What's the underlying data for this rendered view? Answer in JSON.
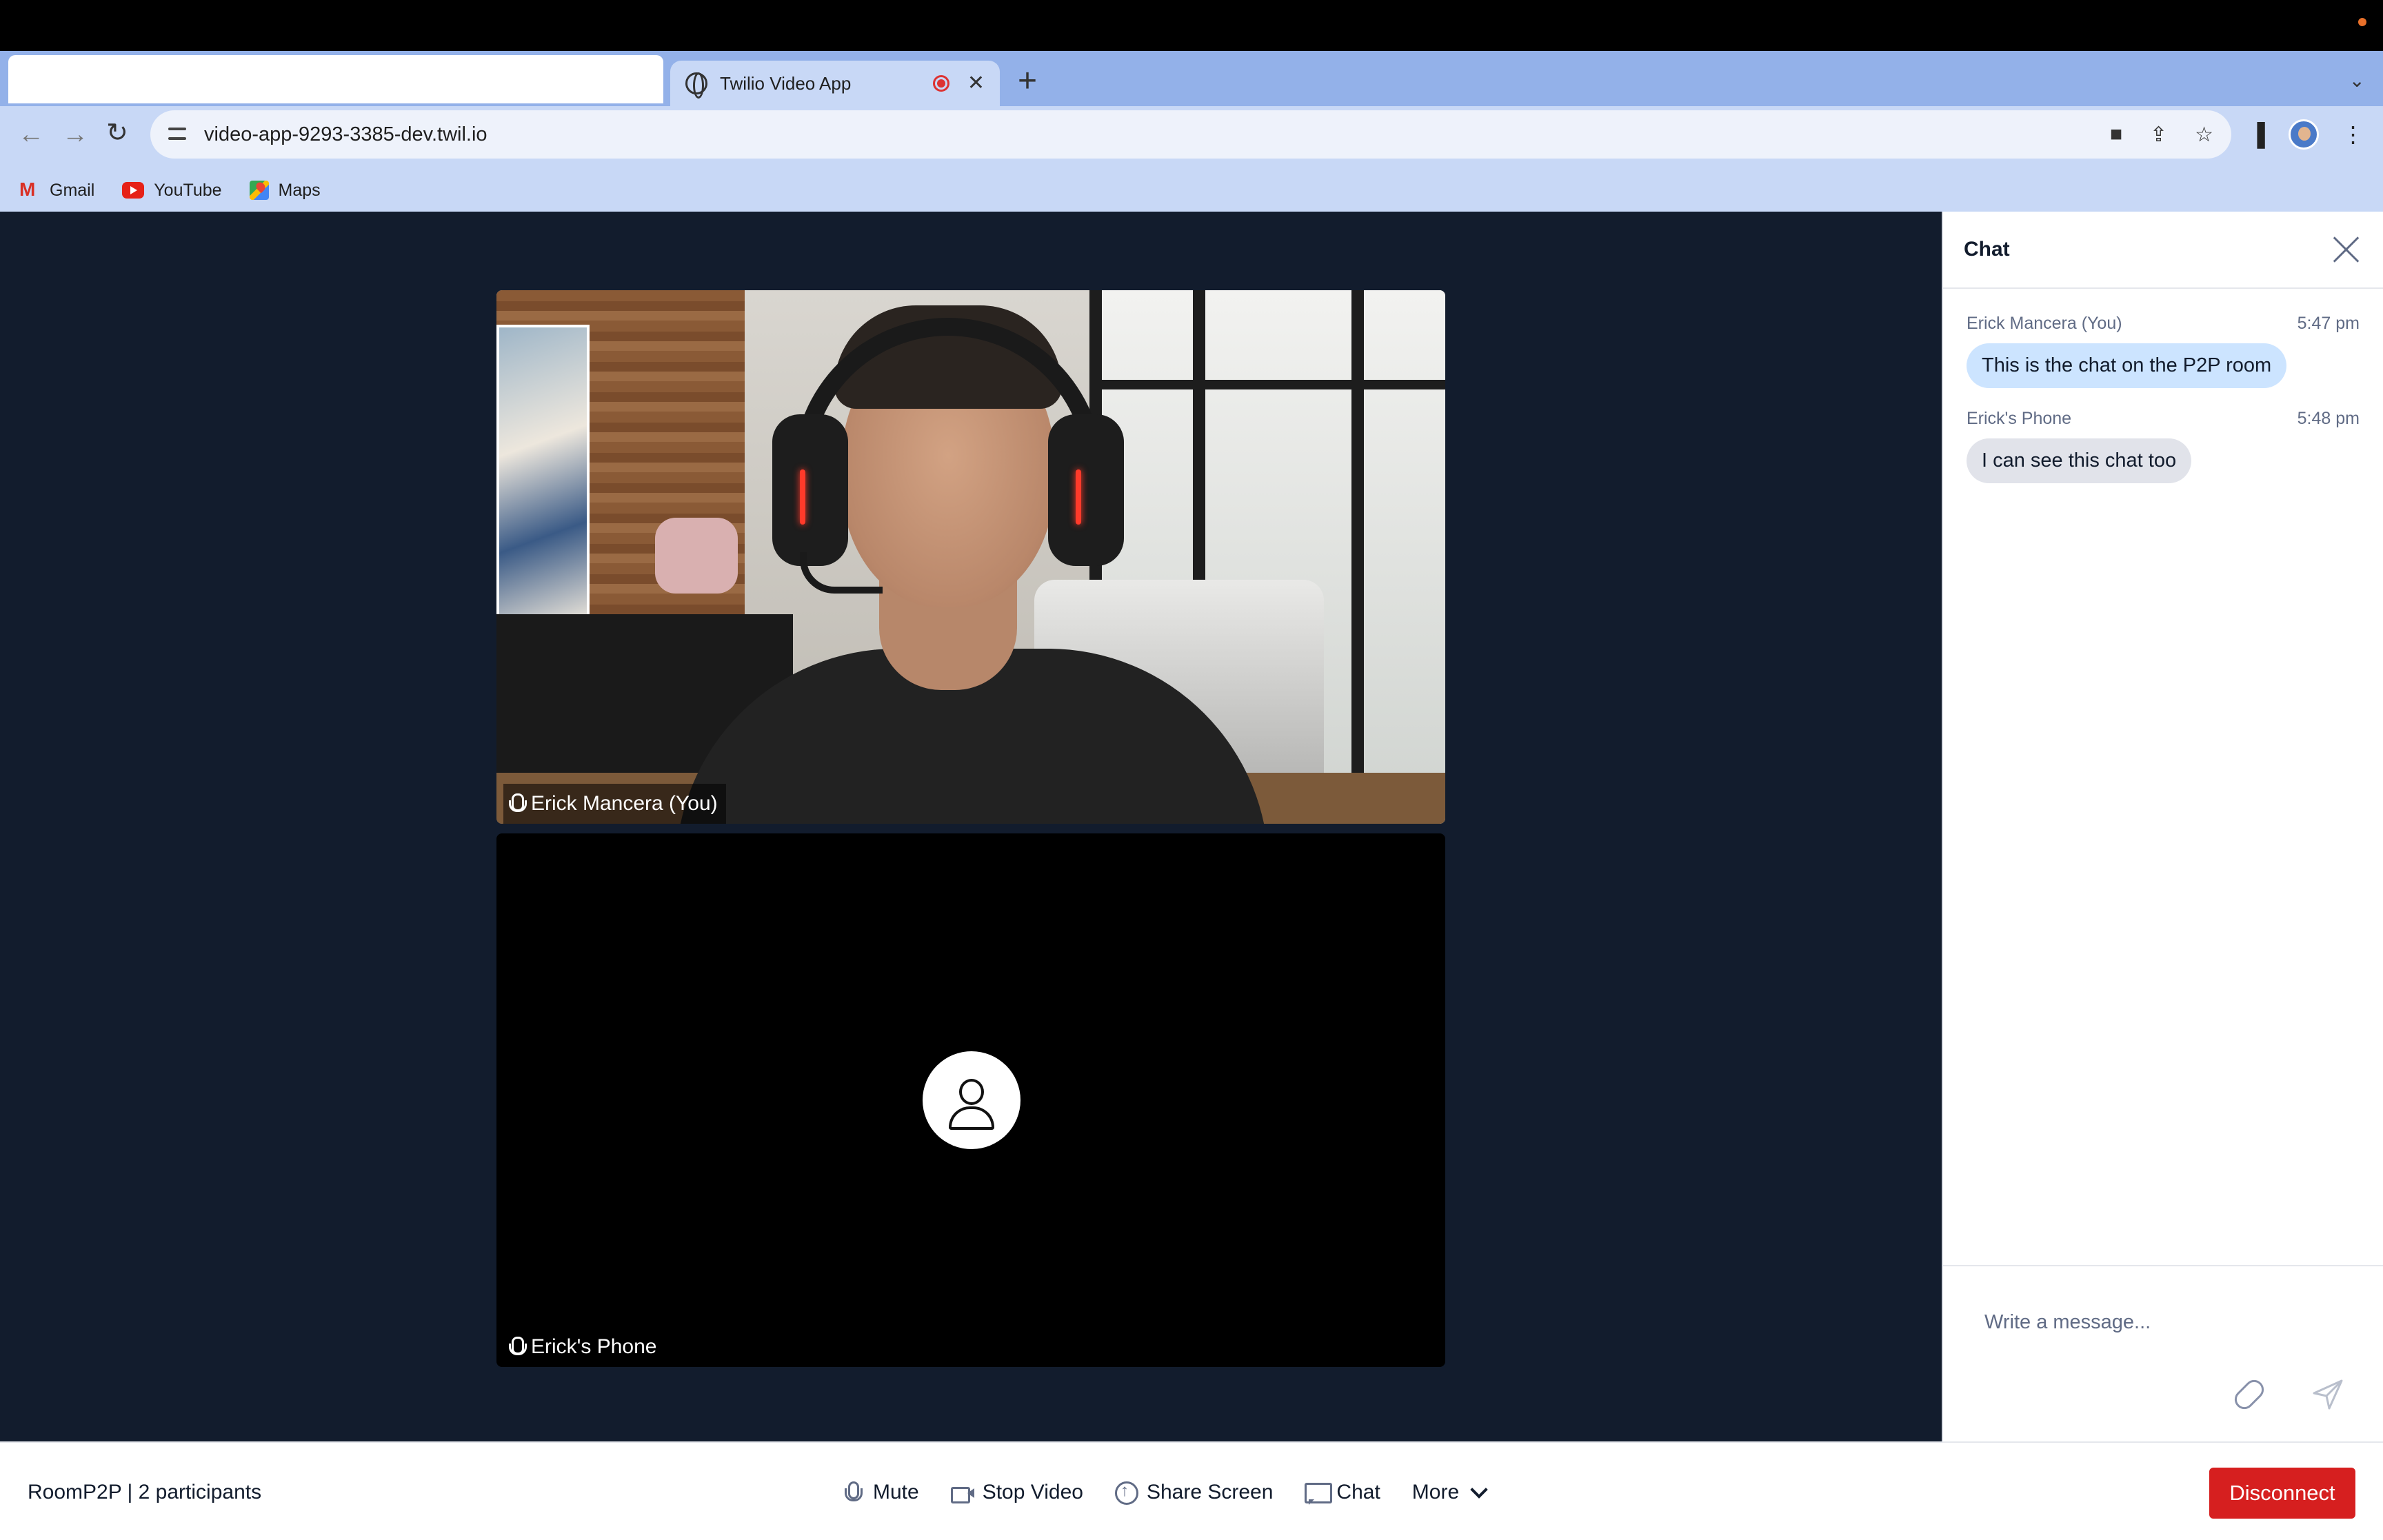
{
  "browser": {
    "tab": {
      "title": "Twilio Video App",
      "favicon": "globe-icon",
      "recording_indicator": "record-icon"
    },
    "url": "video-app-9293-3385-dev.twil.io",
    "bookmarks": [
      {
        "label": "Gmail",
        "icon": "gmail-icon"
      },
      {
        "label": "YouTube",
        "icon": "youtube-icon"
      },
      {
        "label": "Maps",
        "icon": "maps-icon"
      }
    ]
  },
  "participants": [
    {
      "name": "Erick Mancera (You)",
      "video": "on"
    },
    {
      "name": "Erick's Phone",
      "video": "off"
    }
  ],
  "chat": {
    "title": "Chat",
    "messages": [
      {
        "author": "Erick Mancera (You)",
        "time": "5:47 pm",
        "text": "This is the chat on the P2P room",
        "self": true
      },
      {
        "author": "Erick's Phone",
        "time": "5:48 pm",
        "text": "I can see this chat too",
        "self": false
      }
    ],
    "input_placeholder": "Write a message..."
  },
  "footer": {
    "room_info": "RoomP2P | 2 participants",
    "controls": {
      "mute": "Mute",
      "stop_video": "Stop Video",
      "share_screen": "Share Screen",
      "chat": "Chat",
      "more": "More"
    },
    "disconnect": "Disconnect"
  },
  "colors": {
    "stage_bg": "#121c2d",
    "self_bubble": "#cce4ff",
    "other_bubble": "#e1e3ea",
    "disconnect": "#d61f1f"
  }
}
